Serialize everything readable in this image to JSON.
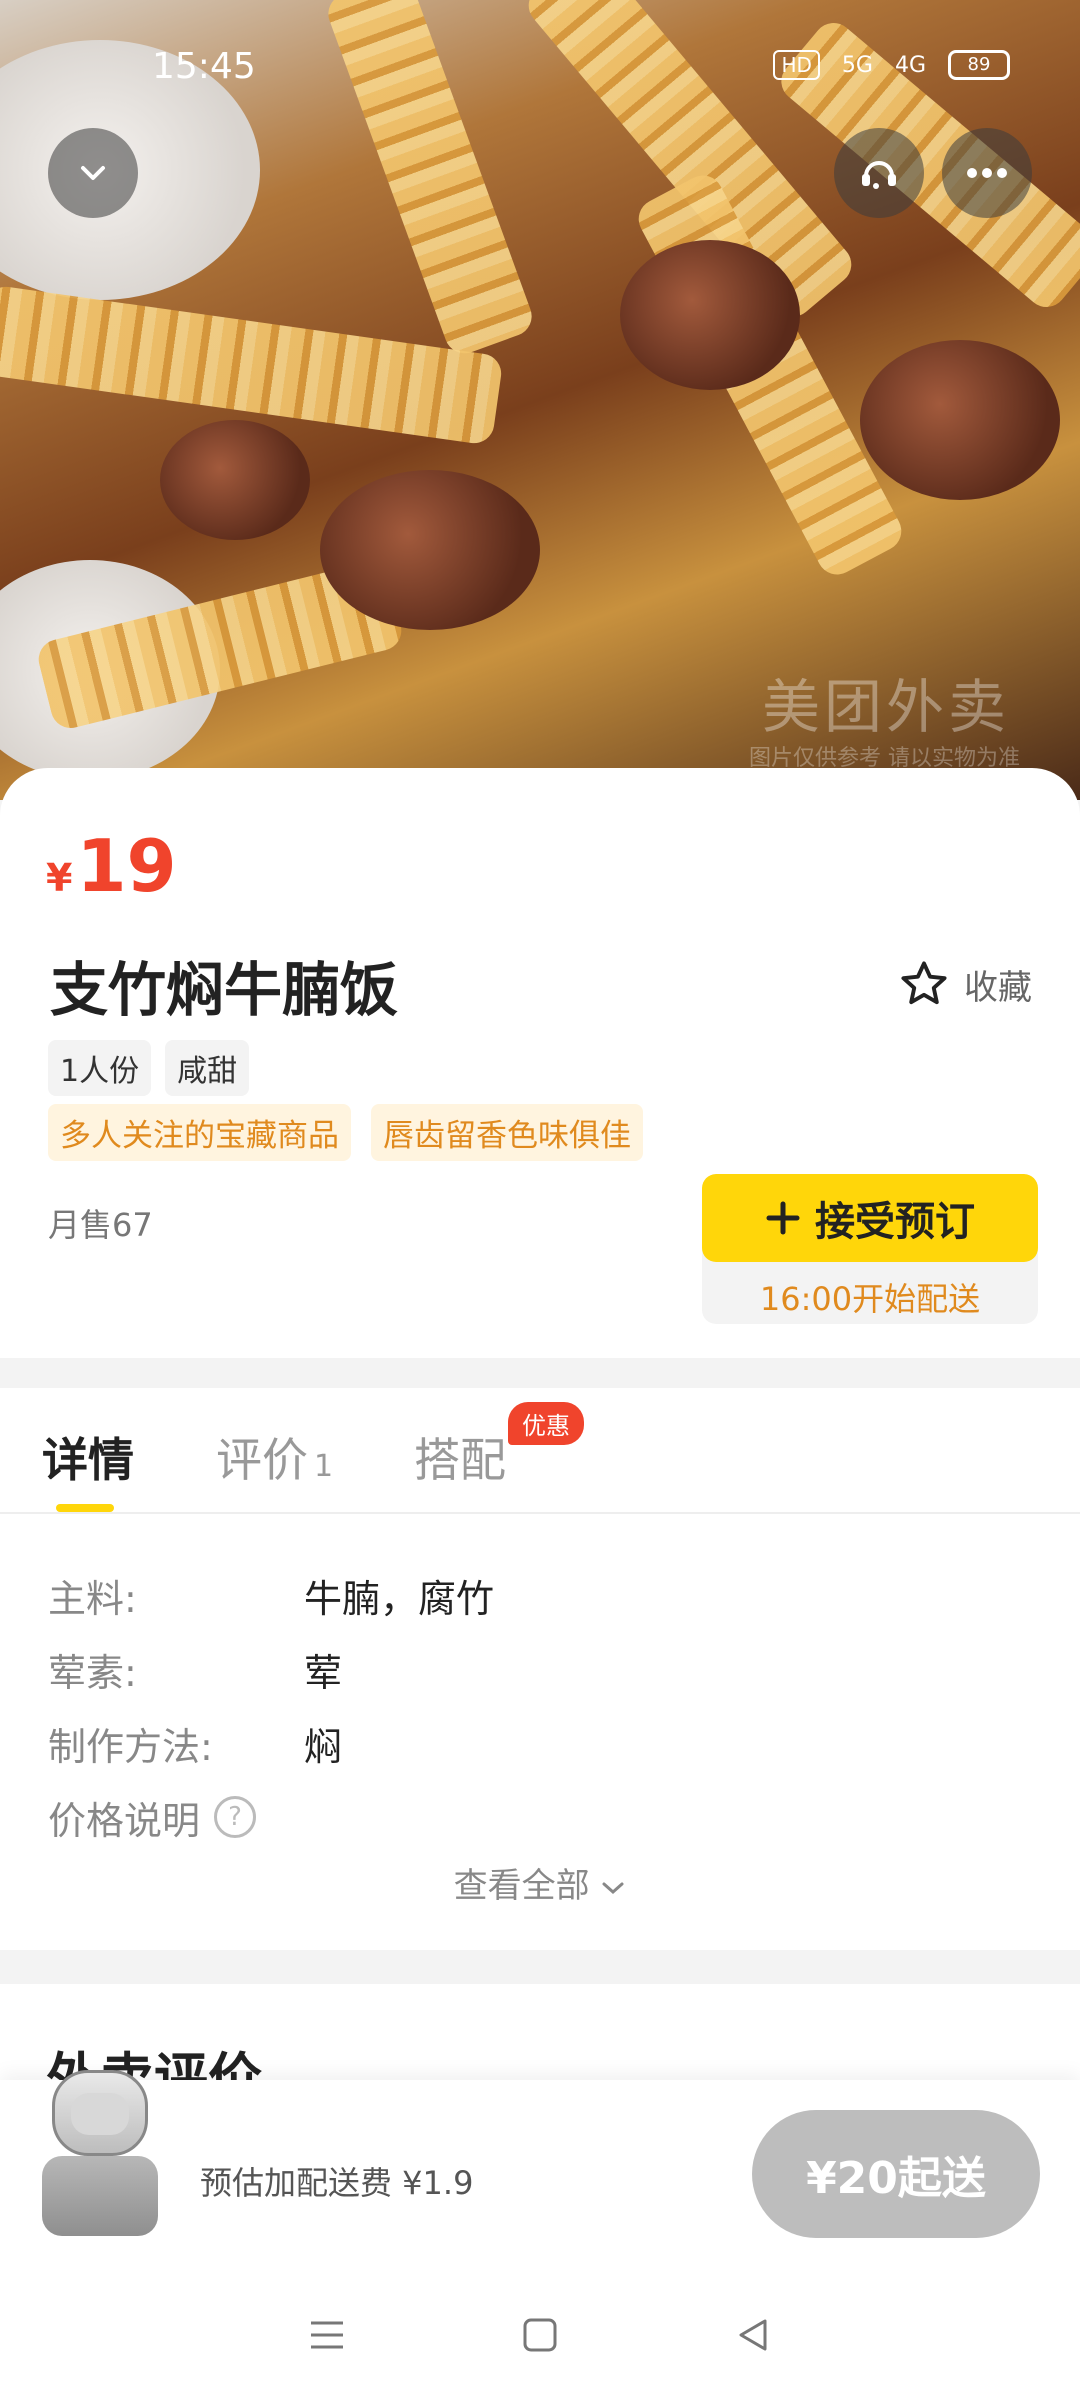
{
  "status_bar": {
    "time": "15:45",
    "hd": "HD",
    "signal_5g": "5G",
    "signal_4g": "4G",
    "battery": "89"
  },
  "hero": {
    "watermark": "美团外卖",
    "watermark_sub": "图片仅供参考 请以实物为准"
  },
  "product": {
    "currency": "¥",
    "price": "19",
    "name": "支竹焖牛腩饭",
    "favorite_label": "收藏",
    "tags": [
      "1人份",
      "咸甜"
    ],
    "highlight_tags": [
      "多人关注的宝藏商品",
      "唇齿留香色味俱佳"
    ],
    "monthly_sales": "月售67",
    "order_button_label": "接受预订",
    "delivery_start": "16:00开始配送"
  },
  "tabs": {
    "details": "详情",
    "reviews": "评价",
    "reviews_count": "1",
    "combo": "搭配",
    "combo_badge": "优惠"
  },
  "details": {
    "rows": [
      {
        "key": "主料:",
        "value": "牛腩，腐竹"
      },
      {
        "key": "荤素:",
        "value": "荤"
      },
      {
        "key": "制作方法:",
        "value": "焖"
      }
    ],
    "price_note": "价格说明",
    "view_all": "查看全部"
  },
  "reviews_section": {
    "title": "外卖评价"
  },
  "bottom_bar": {
    "delivery_fee": "预估加配送费 ¥1.9",
    "min_order_button": "¥20起送"
  },
  "colors": {
    "accent_yellow": "#ffd60a",
    "price_red": "#f0442c",
    "highlight_orange": "#e08a1e"
  }
}
